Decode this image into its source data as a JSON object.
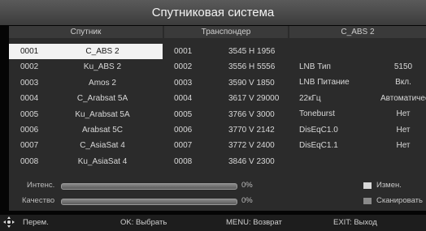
{
  "title": "Спутниковая система",
  "headers": {
    "satellite": "Спутник",
    "transponder": "Транспондер",
    "info": "C_ABS 2"
  },
  "satellites": [
    {
      "num": "0001",
      "name": "C_ABS 2"
    },
    {
      "num": "0002",
      "name": "Ku_ABS 2"
    },
    {
      "num": "0003",
      "name": "Amos 2"
    },
    {
      "num": "0004",
      "name": "C_Arabsat 5A"
    },
    {
      "num": "0005",
      "name": "Ku_Arabsat 5A"
    },
    {
      "num": "0006",
      "name": "Arabsat 5C"
    },
    {
      "num": "0007",
      "name": "C_AsiaSat 4"
    },
    {
      "num": "0008",
      "name": "Ku_AsiaSat 4"
    }
  ],
  "transponders": [
    {
      "num": "0001",
      "value": "3545 H 1956"
    },
    {
      "num": "0002",
      "value": "3556 H 5556"
    },
    {
      "num": "0003",
      "value": "3590 V 1850"
    },
    {
      "num": "0004",
      "value": "3617 V 29000"
    },
    {
      "num": "0005",
      "value": "3766 V 3000"
    },
    {
      "num": "0006",
      "value": "3770 V 2142"
    },
    {
      "num": "0007",
      "value": "3772 V 2400"
    },
    {
      "num": "0008",
      "value": "3846 V 2300"
    }
  ],
  "info": [
    {
      "key": "LNB Тип",
      "value": "5150"
    },
    {
      "key": "LNB Питание",
      "value": "Вкл."
    },
    {
      "key": "22кГц",
      "value": "Автоматически"
    },
    {
      "key": "Toneburst",
      "value": "Нет"
    },
    {
      "key": "DisEqC1.0",
      "value": "Нет"
    },
    {
      "key": "DisEqC1.1",
      "value": "Нет"
    }
  ],
  "signal": {
    "intensity_label": "Интенс.",
    "intensity_pct": "0%",
    "quality_label": "Качество",
    "quality_pct": "0%"
  },
  "legend": {
    "edit": "Измен.",
    "scan": "Сканировать",
    "edit_color": "#d8d8d8",
    "scan_color": "#8a8a8a"
  },
  "footer": {
    "move": "Перем.",
    "ok": "OK: Выбрать",
    "menu": "MENU: Возврат",
    "exit": "EXIT: Выход"
  }
}
